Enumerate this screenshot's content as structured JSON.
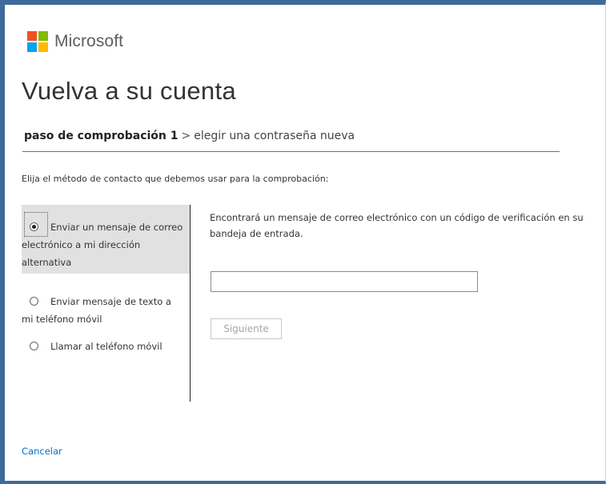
{
  "brand": {
    "name": "Microsoft",
    "logo_colors": [
      "#f25022",
      "#7fba00",
      "#00a4ef",
      "#ffb900"
    ]
  },
  "page": {
    "title": "Vuelva a su cuenta"
  },
  "breadcrumb": {
    "current": "paso de comprobación 1",
    "separator": ">",
    "next": "elegir una contraseña nueva"
  },
  "instruction": "Elija el método de contacto que debemos usar para la comprobación:",
  "contact_methods": [
    {
      "label": "Enviar un mensaje de correo electrónico a mi dirección alternativa",
      "selected": true
    },
    {
      "label": "Enviar mensaje de texto a mi teléfono móvil",
      "selected": false
    },
    {
      "label": "Llamar al teléfono móvil",
      "selected": false
    }
  ],
  "detail": {
    "text": "Encontrará un mensaje de correo electrónico con un código de verificación en su bandeja de entrada.",
    "input_value": "",
    "next_label": "Siguiente"
  },
  "footer": {
    "cancel_label": "Cancelar"
  },
  "colors": {
    "accent_link": "#0072c6",
    "frame": "#3f6a9b",
    "selected_bg": "#e1e1e1"
  }
}
